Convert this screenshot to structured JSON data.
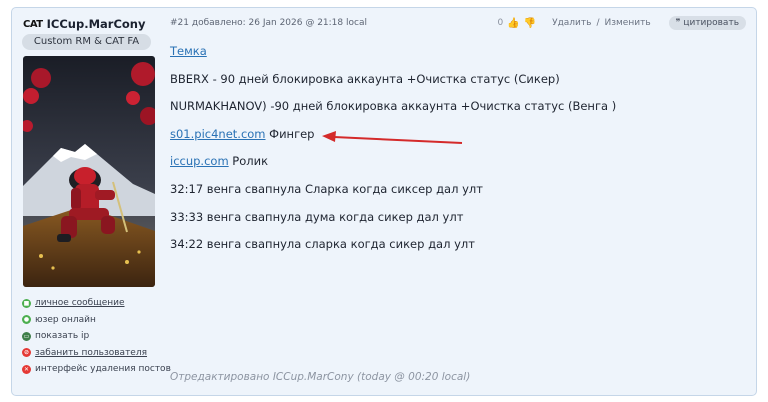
{
  "author": {
    "clan_tag": "CAT",
    "name": "ICCup.MarCony",
    "badge": "Custom RM & CAT FA"
  },
  "side_links": [
    {
      "label": "личное сообщение",
      "icon": "message-icon",
      "color": "#4caf50",
      "link": true
    },
    {
      "label": "юзер онлайн",
      "icon": "online-icon",
      "color": "#4caf50",
      "link": false
    },
    {
      "label": "показать ip",
      "icon": "monitor-icon",
      "color": "#3f7f4a",
      "link": false
    },
    {
      "label": "забанить пользователя",
      "icon": "ban-icon",
      "color": "#e53935",
      "link": true
    },
    {
      "label": "интерфейс удаления постов",
      "icon": "delete-icon",
      "color": "#e53935",
      "link": false
    }
  ],
  "post": {
    "meta": "#21 добавлено: 26 Jan 2026 @ 21:18 local",
    "rating": "0",
    "delete_label": "Удалить",
    "separator": "/",
    "edit_label": "Изменить",
    "quote_label": "цитировать",
    "lines": [
      {
        "link": "Темка",
        "text": ""
      },
      {
        "link": "",
        "text": "BBERX - 90 дней блокировка аккаунта +Очистка статус (Сикер)"
      },
      {
        "link": "",
        "text": "NURMAKHANOV) -90 дней блокировка аккаунта +Очистка статус (Венга )"
      },
      {
        "link": "s01.pic4net.com",
        "text": " Фингер"
      },
      {
        "link": "iccup.com",
        "text": " Ролик"
      },
      {
        "link": "",
        "text": "32:17 венга свапнула Сларка когда сиксер дал улт"
      },
      {
        "link": "",
        "text": "33:33 венга свапнула дума когда сикер дал улт"
      },
      {
        "link": "",
        "text": "34:22 венга свапнула сларка когда сикер дал улт"
      }
    ],
    "edited": "Отредактировано ICCup.MarCony (today @ 00:20 local)"
  },
  "colors": {
    "post_bg": "#eef4fb",
    "link": "#2a72b5",
    "annotation_arrow": "#d42a2a"
  }
}
